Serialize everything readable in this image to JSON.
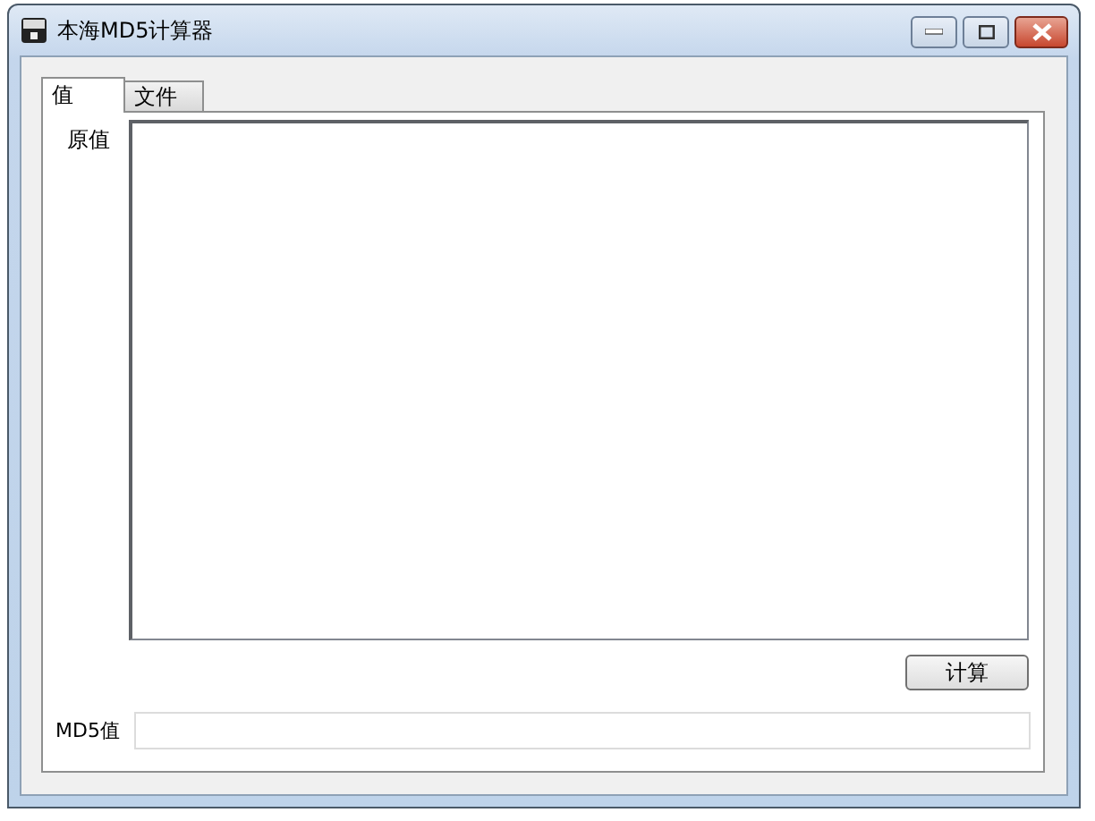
{
  "window": {
    "title": "本海MD5计算器"
  },
  "tabs": [
    {
      "label": "值",
      "selected": true
    },
    {
      "label": "文件",
      "selected": false
    }
  ],
  "input": {
    "label": "原值"
  },
  "compute_button": "计算",
  "output": {
    "label": "MD5值"
  }
}
